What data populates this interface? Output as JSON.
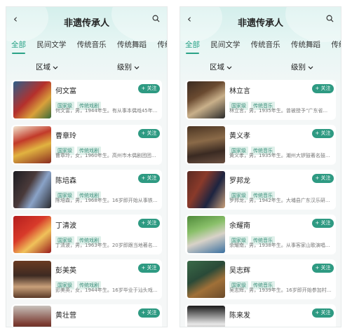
{
  "header": {
    "title": "非遗传承人"
  },
  "tabs": [
    "全部",
    "民间文学",
    "传统音乐",
    "传统舞蹈",
    "传统戏剧"
  ],
  "filters": {
    "region": "区域",
    "level": "级别"
  },
  "follow_label": "+ 关注",
  "left_list": [
    {
      "name": "何文富",
      "tags": [
        "国家级",
        "传统戏剧"
      ],
      "desc": "何文富，男，1944年生。有从事本偶戏45年..."
    },
    {
      "name": "曹章玲",
      "tags": [
        "国家级",
        "传统戏剧"
      ],
      "desc": "曹章玲，女，1960年生。高州市木偶剧团团..."
    },
    {
      "name": "陈培森",
      "tags": [
        "国家级",
        "传统戏剧"
      ],
      "desc": "陈培森，男，1968年生。16岁即开始从事铁..."
    },
    {
      "name": "丁清波",
      "tags": [
        "国家级",
        "传统戏剧"
      ],
      "desc": "丁清波，男，1963年生。20岁即跟当地著名..."
    },
    {
      "name": "彭美英",
      "tags": [
        "国家级",
        "传统戏剧"
      ],
      "desc": "彭美英，女，1944年生。16岁毕业于汕头戏..."
    },
    {
      "name": "黄壮营",
      "tags": [],
      "desc": ""
    }
  ],
  "right_list": [
    {
      "name": "林立言",
      "tags": [
        "国家级",
        "传统音乐"
      ],
      "desc": "林立言，男，1935年生。曾被授予“广东省..."
    },
    {
      "name": "黄义孝",
      "tags": [
        "国家级",
        "传统音乐"
      ],
      "desc": "黄义孝，男，1935年生。潮州大锣鼓著名鼓..."
    },
    {
      "name": "罗邦龙",
      "tags": [
        "国家级",
        "传统音乐"
      ],
      "desc": "罗邦龙，男，1942年生。大埔县广东汉乐研..."
    },
    {
      "name": "余耀南",
      "tags": [
        "国家级",
        "传统音乐"
      ],
      "desc": "余耀南，男，1938年生。从事客家山歌演唱..."
    },
    {
      "name": "吴志辉",
      "tags": [
        "国家级",
        "传统音乐"
      ],
      "desc": "吴志辉，男，1939年生。16岁即开始参加村..."
    },
    {
      "name": "陈来发",
      "tags": [],
      "desc": ""
    }
  ]
}
